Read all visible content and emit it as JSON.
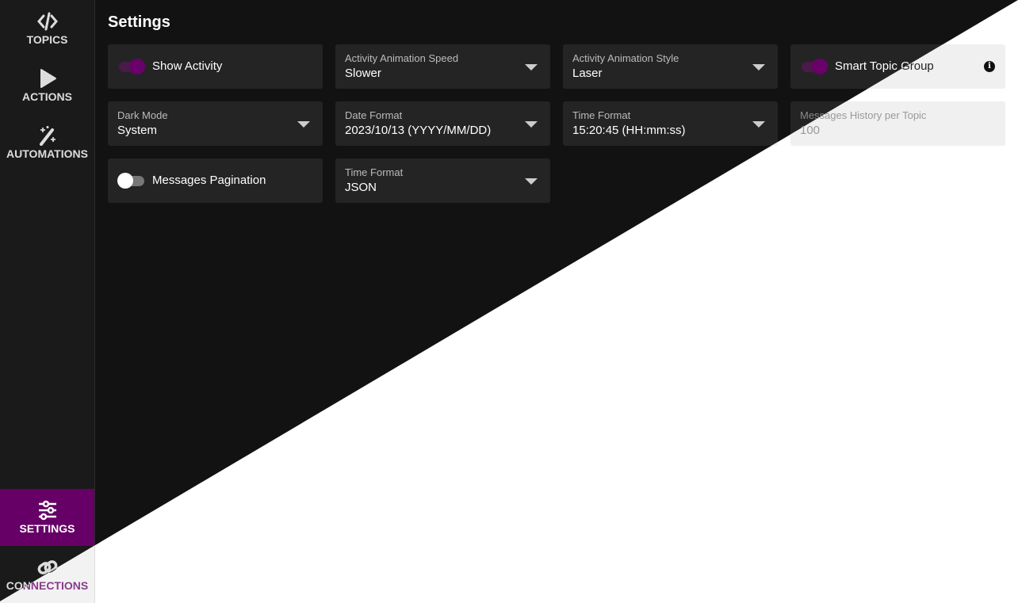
{
  "sidebar": {
    "items": [
      {
        "label": "TOPICS",
        "icon": "code-icon"
      },
      {
        "label": "ACTIONS",
        "icon": "play-icon"
      },
      {
        "label": "AUTOMATIONS",
        "icon": "magic-wand-icon"
      },
      {
        "label": "SETTINGS",
        "icon": "sliders-icon",
        "active": true
      },
      {
        "label": "CONNECTIONS",
        "icon": "link-icon"
      }
    ]
  },
  "page": {
    "title": "Settings"
  },
  "settings": {
    "show_activity": {
      "label": "Show Activity",
      "on": true
    },
    "animation_speed": {
      "label": "Activity Animation Speed",
      "value": "Slower"
    },
    "animation_style": {
      "label": "Activity Animation Style",
      "value": "Laser"
    },
    "smart_topic_group": {
      "label": "Smart Topic Group",
      "on": true,
      "info": "i"
    },
    "dark_mode": {
      "label": "Dark Mode",
      "value": "System"
    },
    "date_format": {
      "label": "Date Format",
      "value": "2023/10/13 (YYYY/MM/DD)"
    },
    "time_format": {
      "label": "Time Format",
      "value": "15:20:45 (HH:mm:ss)"
    },
    "messages_history": {
      "label": "Messages History per Topic",
      "value": "100"
    },
    "messages_pagination": {
      "label": "Messages Pagination",
      "on": false
    },
    "message_format": {
      "label": "Time Format",
      "value": "JSON"
    }
  },
  "colors": {
    "accent": "#660066",
    "dark_bg": "#121212",
    "card_dark": "#242424"
  }
}
